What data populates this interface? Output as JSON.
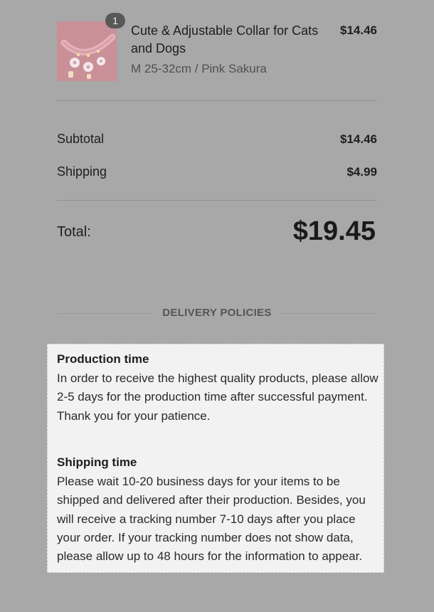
{
  "order_item": {
    "quantity": "1",
    "name": "Cute & Adjustable Collar for Cats and Dogs",
    "variant": "M 25-32cm / Pink Sakura",
    "price": "$14.46",
    "image_icon": "pink-collar-product-image"
  },
  "summary": {
    "subtotal_label": "Subtotal",
    "subtotal_value": "$14.46",
    "shipping_label": "Shipping",
    "shipping_value": "$4.99",
    "total_label": "Total:",
    "total_value": "$19.45"
  },
  "policies": {
    "heading": "DELIVERY POLICIES",
    "production_title": "Production time",
    "production_text": "In order to receive the highest quality products, please allow 2-5 days for the production time after successful payment. Thank you for your patience.",
    "shipping_title": "Shipping time",
    "shipping_text": "Please wait 10-20 business days for your items to be shipped and delivered after their production. Besides, you will receive a tracking number 7-10 days after you place your order. If your tracking number does not show data, please allow up to 48 hours for the information to appear."
  },
  "colors": {
    "page_background": "#a8a8a8",
    "policy_box_background": "#f2f2f2",
    "badge_background": "#585858",
    "thumbnail_pink": "#c58f97"
  }
}
